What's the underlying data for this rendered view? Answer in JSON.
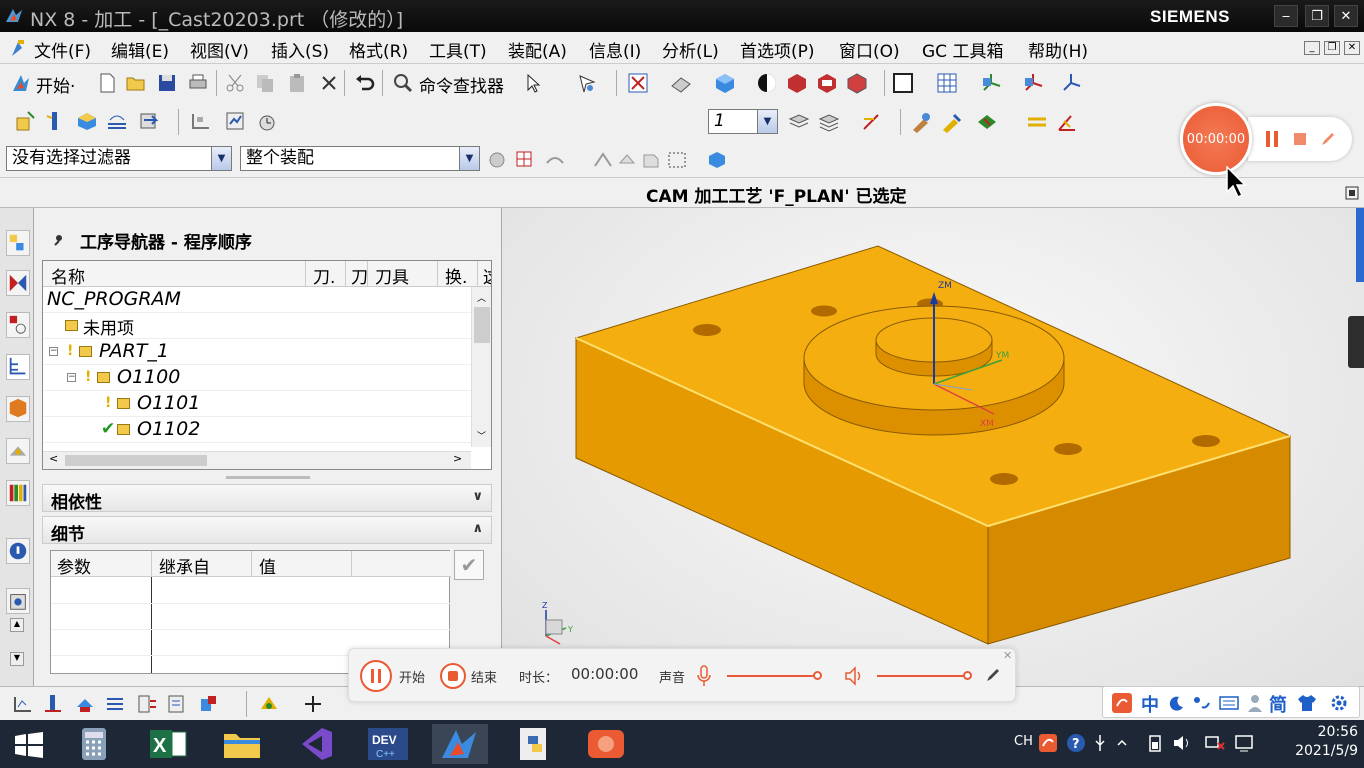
{
  "window": {
    "title": "NX 8 - 加工 - [_Cast20203.prt （修改的）]",
    "brand": "SIEMENS",
    "minimize": "‒",
    "restore": "❐",
    "close": "✕"
  },
  "menu": {
    "items": [
      {
        "label": "文件(F)"
      },
      {
        "label": "编辑(E)"
      },
      {
        "label": "视图(V)"
      },
      {
        "label": "插入(S)"
      },
      {
        "label": "格式(R)"
      },
      {
        "label": "工具(T)"
      },
      {
        "label": "装配(A)"
      },
      {
        "label": "信息(I)"
      },
      {
        "label": "分析(L)"
      },
      {
        "label": "首选项(P)"
      },
      {
        "label": "窗口(O)"
      },
      {
        "label": "GC 工具箱"
      },
      {
        "label": "帮助(H)"
      }
    ]
  },
  "toolbar1": {
    "start_label": "开始·",
    "command_finder": "命令查找器"
  },
  "toolbar2": {
    "layer_value": "1"
  },
  "selection": {
    "filter": "没有选择过滤器",
    "scope": "整个装配"
  },
  "status": {
    "message": "CAM 加工工艺 'F_PLAN' 已选定"
  },
  "navigator": {
    "title": "工序导航器 - 程序顺序",
    "columns": [
      "名称",
      "刀.",
      "刀",
      "刀具",
      "换.",
      "这"
    ],
    "rows": [
      {
        "name": "NC_PROGRAM"
      },
      {
        "name": "未用项"
      },
      {
        "name": "PART_1"
      },
      {
        "name": "O1100"
      },
      {
        "name": "O1101"
      },
      {
        "name": "O1102"
      }
    ],
    "dependency_label": "相依性",
    "details_label": "细节",
    "detail_columns": [
      "参数",
      "继承自",
      "值"
    ]
  },
  "axes": {
    "zm": "ZM",
    "ym": "YM",
    "xm": "XM",
    "z": "Z",
    "y": "Y"
  },
  "recorder": {
    "timer": "00:00:00",
    "start": "开始",
    "stop": "结束",
    "duration_label": "时长：",
    "duration": "00:00:00",
    "sound_label": "声音"
  },
  "ime": {
    "mode": "中",
    "simplified": "简"
  },
  "taskbar": {
    "lang": "CH",
    "time": "20:56",
    "date": "2021/5/9"
  },
  "colors": {
    "part": "#f3a712",
    "part_side": "#d98e00",
    "recorder": "#ea5a33"
  }
}
